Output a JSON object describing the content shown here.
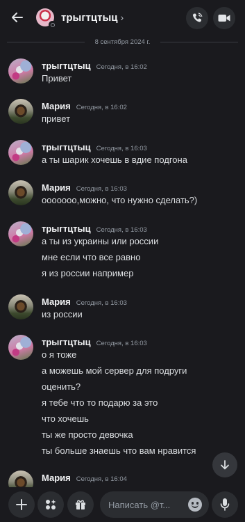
{
  "header": {
    "title": "трыгтцтыц",
    "chevron": "›",
    "icons": [
      "back-arrow-icon",
      "phone-icon",
      "video-camera-icon"
    ]
  },
  "date_divider": "8 сентября 2024 г.",
  "messages": [
    {
      "author": "трыгтцтыц",
      "time": "Сегодня, в 16:02",
      "avatar": "flower",
      "lines": [
        "Привет"
      ]
    },
    {
      "author": "Мария",
      "time": "Сегодня, в 16:02",
      "avatar": "dog",
      "lines": [
        "привет"
      ]
    },
    {
      "author": "трыгтцтыц",
      "time": "Сегодня, в 16:03",
      "avatar": "flower",
      "lines": [
        "а ты шарик хочешь в вдие подгона"
      ]
    },
    {
      "author": "Мария",
      "time": "Сегодня, в 16:03",
      "avatar": "dog",
      "lines": [
        "ооооооо,можно, что нужно сделать?)"
      ]
    },
    {
      "author": "трыгтцтыц",
      "time": "Сегодня, в 16:03",
      "avatar": "flower",
      "lines": [
        "а ты из украины или россии",
        "мне если что все равно",
        "я из россии например"
      ]
    },
    {
      "author": "Мария",
      "time": "Сегодня, в 16:03",
      "avatar": "dog",
      "lines": [
        "из россии"
      ]
    },
    {
      "author": "трыгтцтыц",
      "time": "Сегодня, в 16:03",
      "avatar": "flower",
      "lines": [
        "о я тоже",
        "а можешь мой сервер для подруги",
        "оценить?",
        "я тебе что то подарю за это",
        "что хочешь",
        "ты же просто девочка",
        "ты больше знаешь что вам нравится"
      ]
    },
    {
      "author": "Мария",
      "time": "Сегодня, в 16:04",
      "avatar": "dog",
      "lines": []
    }
  ],
  "composer": {
    "placeholder": "Написать @т...",
    "icons": [
      "plus-icon",
      "apps-icon",
      "gift-icon",
      "emoji-icon",
      "microphone-icon"
    ]
  },
  "scroll_button_icon": "arrow-down-icon",
  "colors": {
    "background": "#1a1a1e",
    "surface": "#2b2d31",
    "text": "#dbdee1",
    "muted": "#949ba4"
  }
}
